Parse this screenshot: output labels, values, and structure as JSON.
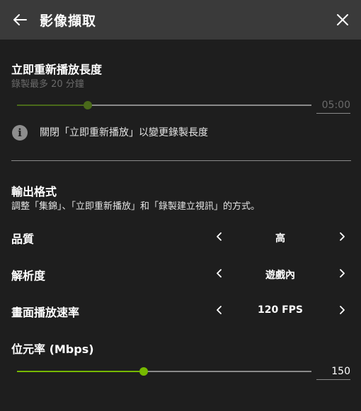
{
  "header": {
    "title": "影像擷取",
    "back_icon": "arrow-left-icon",
    "close_icon": "close-x-icon"
  },
  "instant_replay": {
    "title": "立即重新播放長度",
    "subtitle": "錄製最多 20 分鐘",
    "slider_fraction": 0.24,
    "value": "05:00",
    "info_icon": "info-icon",
    "info_text": "關閉「立即重新播放」以變更錄製長度"
  },
  "output_format": {
    "title": "輸出格式",
    "subtitle": "調整「集錦」、「立即重新播放」和「錄製建立視訊」的方式。",
    "rows": [
      {
        "label": "品質",
        "value": "高"
      },
      {
        "label": "解析度",
        "value": "遊戲內"
      },
      {
        "label": "畫面播放速率",
        "value": "120 FPS"
      }
    ]
  },
  "bitrate": {
    "label": "位元率 (Mbps)",
    "value": "150",
    "slider_fraction": 0.43
  },
  "colors": {
    "accent": "#76b900",
    "accent_disabled": "#4a6a1a",
    "header_bg": "#3a3a3a",
    "bg": "#1e1e1e"
  }
}
